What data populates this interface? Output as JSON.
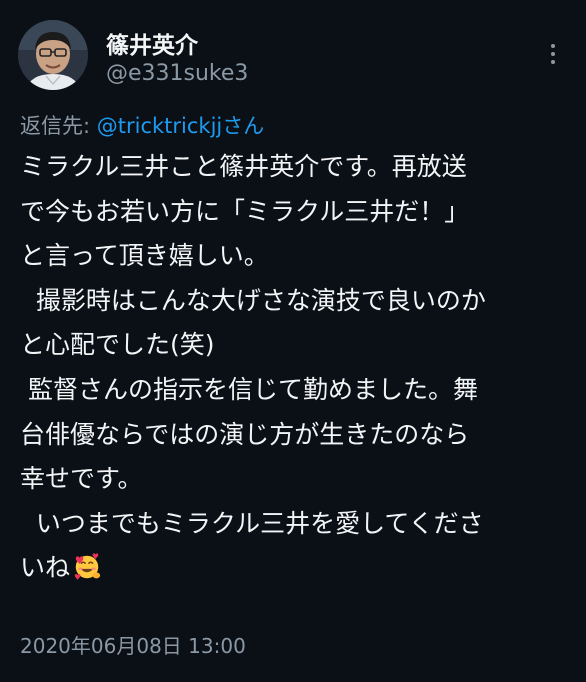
{
  "author": {
    "display_name": "篠井英介",
    "handle": "@e331suke3"
  },
  "more_icon": "more-vertical-icon",
  "reply": {
    "prefix": "返信先: ",
    "mention": "@tricktrickjj",
    "suffix": "さん"
  },
  "tweet": {
    "lines": [
      "ミラクル三井こと篠井英介です。再放送",
      "で今もお若い方に「ミラクル三井だ！」",
      "と言って頂き嬉しい。",
      "  撮影時はこんな大げさな演技で良いのか",
      "と心配でした(笑)",
      " 監督さんの指示を信じて勤めました。舞",
      "台俳優ならではの演じ方が生きたのなら",
      "幸せです。",
      "  いつまでもミラクル三井を愛してくださ",
      "いね"
    ],
    "emoji": "smiling-face-with-hearts-icon"
  },
  "timestamp": "2020年06月08日 13:00",
  "colors": {
    "background": "#0b1016",
    "text": "#f2f4f6",
    "secondary": "#8b98a5",
    "link": "#1d9bf0"
  }
}
